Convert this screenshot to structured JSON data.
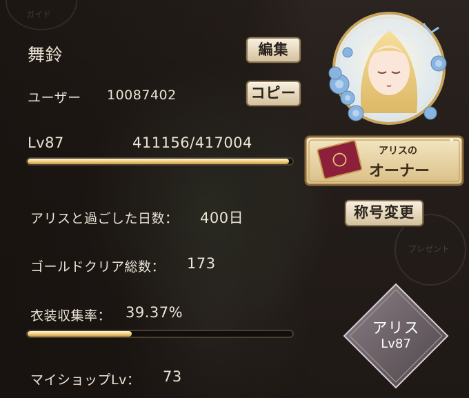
{
  "profile": {
    "name": "舞鈴",
    "edit_label": "編集",
    "user_label": "ユーザー",
    "user_id": "10087402",
    "copy_label": "コピー",
    "level_label": "Lv87",
    "exp_text": "411156/417004",
    "exp_progress": 0.986
  },
  "stats": {
    "days_label": "アリスと過ごした日数：",
    "days_value": "400日",
    "gold_label": "ゴールドクリア総数：",
    "gold_value": "173",
    "costume_label": "衣装収集率：",
    "costume_value": "39.37%",
    "costume_progress": 0.3937,
    "shop_label": "マイショップLv：",
    "shop_value": "73"
  },
  "badge": {
    "line1": "アリスの",
    "line2": "オーナー"
  },
  "title_change_label": "称号変更",
  "diamond": {
    "name": "アリス",
    "level": "Lv87"
  },
  "background_ghost": {
    "guide": "ガイド",
    "present": "プレゼント"
  },
  "colors": {
    "gold": "#f3d48a",
    "button_bg": "#efe3cc",
    "badge_bg": "#e9d6a6",
    "accent_blue": "#8ab4e0"
  }
}
